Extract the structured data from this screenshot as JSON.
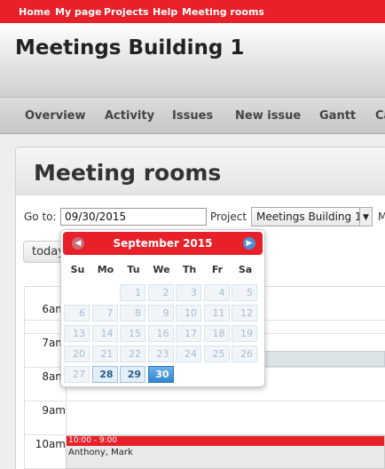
{
  "topnav": [
    "Home",
    "My page",
    "Projects",
    "Help",
    "Meeting rooms"
  ],
  "project_title": "Meetings Building 1",
  "mainmenu": [
    "Overview",
    "Activity",
    "Issues",
    "New issue",
    "Gantt",
    "Ca"
  ],
  "page_title": "Meeting rooms",
  "goto_label": "Go to:",
  "date_value": "09/30/2015",
  "project_label": "Project",
  "project_value": "Meetings Building 1",
  "next_label_fragment": "M",
  "today_button": "today",
  "datepicker": {
    "month": "September 2015",
    "weekdays": [
      "Su",
      "Mo",
      "Tu",
      "We",
      "Th",
      "Fr",
      "Sa"
    ],
    "weeks": [
      [
        "",
        "",
        "1",
        "2",
        "3",
        "4",
        "5"
      ],
      [
        "6",
        "7",
        "8",
        "9",
        "10",
        "11",
        "12"
      ],
      [
        "13",
        "14",
        "15",
        "16",
        "17",
        "18",
        "19"
      ],
      [
        "20",
        "21",
        "22",
        "23",
        "24",
        "25",
        "26"
      ],
      [
        "27",
        "28",
        "29",
        "30",
        "",
        "",
        ""
      ]
    ],
    "selected": "30",
    "current_range": [
      "28",
      "29"
    ]
  },
  "time_slots": [
    "6am",
    "7am",
    "8am",
    "9am",
    "10am"
  ],
  "event": {
    "time": "10:00 - 9:00",
    "title": "Anthony, Mark"
  },
  "colors": {
    "accent": "#e8202a",
    "selected_day": "#2f86cf"
  }
}
